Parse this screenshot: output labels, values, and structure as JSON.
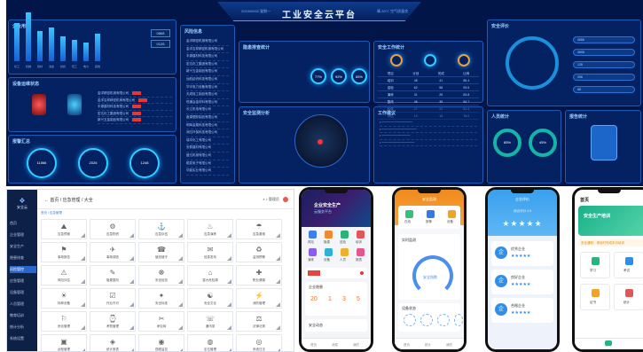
{
  "dashboard": {
    "title": "工业安全云平台",
    "date": "2019/09/02 星期一",
    "weather": "晴 26°C 空气质量良",
    "panels": {
      "enterprise": "企业用户",
      "equipment": "设备运维状态",
      "alarm": "报警汇总",
      "risk_list": "风险信息",
      "hazard": "隐患排查统计",
      "safety_analysis": "安全监测分析",
      "work": "安全工作统计",
      "work_tip": "工作建议",
      "safety_eval": "安全评价",
      "personnel": "人员统计",
      "report": "报告统计"
    },
    "bars": [
      62,
      78,
      48,
      55,
      40,
      35,
      30,
      44
    ],
    "bar_labels": [
      "化工",
      "机械",
      "建材",
      "冶金",
      "纺织",
      "轻工",
      "电力",
      "其他"
    ],
    "led_values": [
      "0868",
      "0126"
    ],
    "risk_rows": [
      "金洋精密机械有限公司",
      "金洋吉祥精密机械有限公司",
      "丰源建材科技有限公司",
      "宏达化工集团有限公司",
      "新兴五金制品有限公司",
      "远航纺织科技有限公司",
      "华宇电力设备有限公司",
      "天成轻工制品有限公司",
      "恒通冶金材料有限公司",
      "长江机电有限公司",
      "鑫源塑胶制品有限公司",
      "明辉金属科技有限公司",
      "润达环保科技有限公司",
      "瑞丰化工有限公司",
      "安泰建材有限公司",
      "盛达机械有限公司",
      "顺发电子有限公司",
      "华能实业有限公司"
    ],
    "alarm_rings": [
      "11566",
      "2026",
      "1248"
    ],
    "alarm_labels": [
      "报警总数",
      "已处理",
      "未处理"
    ],
    "rings_mid": [
      "77%",
      "92%",
      "65%"
    ],
    "work_table": [
      [
        "项目",
        "计划",
        "完成",
        "比例"
      ],
      [
        "培训",
        "48",
        "41",
        "85.4"
      ],
      [
        "巡检",
        "62",
        "58",
        "93.5"
      ],
      [
        "演练",
        "31",
        "26",
        "83.8"
      ],
      [
        "整改",
        "46",
        "39",
        "84.7"
      ],
      [
        "检修",
        "27",
        "22",
        "81.4"
      ],
      [
        "评估",
        "19",
        "15",
        "78.9"
      ]
    ],
    "top_right_stats": [
      "2656",
      "3698",
      "128",
      "396",
      "68"
    ],
    "percent_a": "85%",
    "percent_b": "45%"
  },
  "admin": {
    "logo": "安全云",
    "page_title": "← 首页 / 应急管理 / 大全",
    "crumb": "首页 / 应急管理",
    "user": "管理员",
    "menu": [
      "首页",
      "企业管理",
      "安全生产",
      "隐患排查",
      "风险管控",
      "应急管理",
      "设备管理",
      "人员管理",
      "教育培训",
      "统计分析",
      "系统设置"
    ],
    "active_index": 4,
    "grid_items": [
      {
        "icon": "⛰",
        "label": "应急预案"
      },
      {
        "icon": "⚙",
        "label": "应急物资"
      },
      {
        "icon": "⚓",
        "label": "应急队伍"
      },
      {
        "icon": "♨",
        "label": "应急演练"
      },
      {
        "icon": "☂",
        "label": "应急避难"
      },
      {
        "icon": "⚑",
        "label": "事故报告"
      },
      {
        "icon": "✈",
        "label": "事故调查"
      },
      {
        "icon": "☎",
        "label": "值班值守"
      },
      {
        "icon": "✉",
        "label": "信息发布"
      },
      {
        "icon": "♻",
        "label": "监测预警"
      },
      {
        "icon": "⚠",
        "label": "风险评估"
      },
      {
        "icon": "✎",
        "label": "隐患整改"
      },
      {
        "icon": "☸",
        "label": "安全检查"
      },
      {
        "icon": "⌂",
        "label": "重大危险源"
      },
      {
        "icon": "✚",
        "label": "职业健康"
      },
      {
        "icon": "☀",
        "label": "特种设备"
      },
      {
        "icon": "☑",
        "label": "作业许可"
      },
      {
        "icon": "✦",
        "label": "安全标准"
      },
      {
        "icon": "☯",
        "label": "安全文化"
      },
      {
        "icon": "⚡",
        "label": "消防管理"
      },
      {
        "icon": "⚐",
        "label": "危化管理"
      },
      {
        "icon": "⌚",
        "label": "考勤管理"
      },
      {
        "icon": "✂",
        "label": "承包商"
      },
      {
        "icon": "☏",
        "label": "通讯录"
      },
      {
        "icon": "⚖",
        "label": "法律法规"
      },
      {
        "icon": "▣",
        "label": "台账管理"
      },
      {
        "icon": "◈",
        "label": "统计报表"
      },
      {
        "icon": "◉",
        "label": "视频监控"
      },
      {
        "icon": "◍",
        "label": "定位管理"
      },
      {
        "icon": "◎",
        "label": "系统日志"
      }
    ]
  },
  "phone1": {
    "banner_line1": "企业安全生产",
    "banner_line2": "云服务平台",
    "icons": [
      "风险",
      "隐患",
      "巡检",
      "培训",
      "演练",
      "设备",
      "人员",
      "报表"
    ],
    "section": "企业隐患",
    "numbers": [
      "20",
      "1",
      "3",
      "5"
    ],
    "section2": "安全动态",
    "tabs": [
      "首页",
      "消息",
      "我的"
    ]
  },
  "phone2": {
    "header": "安全监测",
    "icons": [
      "在线",
      "报警",
      "设备"
    ],
    "section": "实时监测",
    "gauge_label": "安全指数",
    "section2": "设备状态",
    "tabs": [
      "首页",
      "统计",
      "我的"
    ]
  },
  "phone3": {
    "header": "企业评价",
    "score": "综合评分 4.5",
    "items": [
      {
        "badge": "企",
        "name": "优秀企业"
      },
      {
        "badge": "企",
        "name": "良好企业"
      },
      {
        "badge": "企",
        "name": "合格企业"
      }
    ]
  },
  "phone4": {
    "header": "首页",
    "banner": "安全生产培训",
    "notice": "安全通知：请及时完成本月培训",
    "cards": [
      "学习",
      "考试",
      "证书",
      "统计"
    ],
    "tabs": [
      "首页",
      "我的"
    ]
  }
}
